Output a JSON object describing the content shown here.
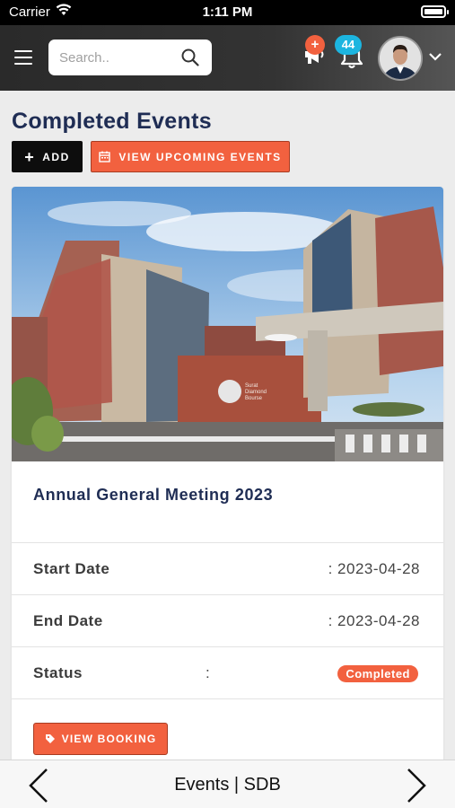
{
  "status_bar": {
    "carrier": "Carrier",
    "time": "1:11 PM"
  },
  "header": {
    "search_placeholder": "Search..",
    "announcement_badge": "+",
    "notification_count": "44"
  },
  "page": {
    "title": "Completed Events",
    "add_label": "ADD",
    "upcoming_label": "VIEW UPCOMING EVENTS"
  },
  "event": {
    "title": "Annual General Meeting 2023",
    "start_label": "Start Date",
    "start_value": ": 2023-04-28",
    "end_label": "End Date",
    "end_value": ": 2023-04-28",
    "status_label": "Status",
    "status_colon": ":",
    "status_value": "Completed",
    "booking_label": "VIEW BOOKING",
    "building_sign_line1": "Surat",
    "building_sign_line2": "Diamond",
    "building_sign_line3": "Bourse"
  },
  "bottom_nav": {
    "title": "Events | SDB"
  },
  "colors": {
    "accent": "#f2613f",
    "title": "#1f2d54",
    "badge_blue": "#1cb5e0"
  }
}
